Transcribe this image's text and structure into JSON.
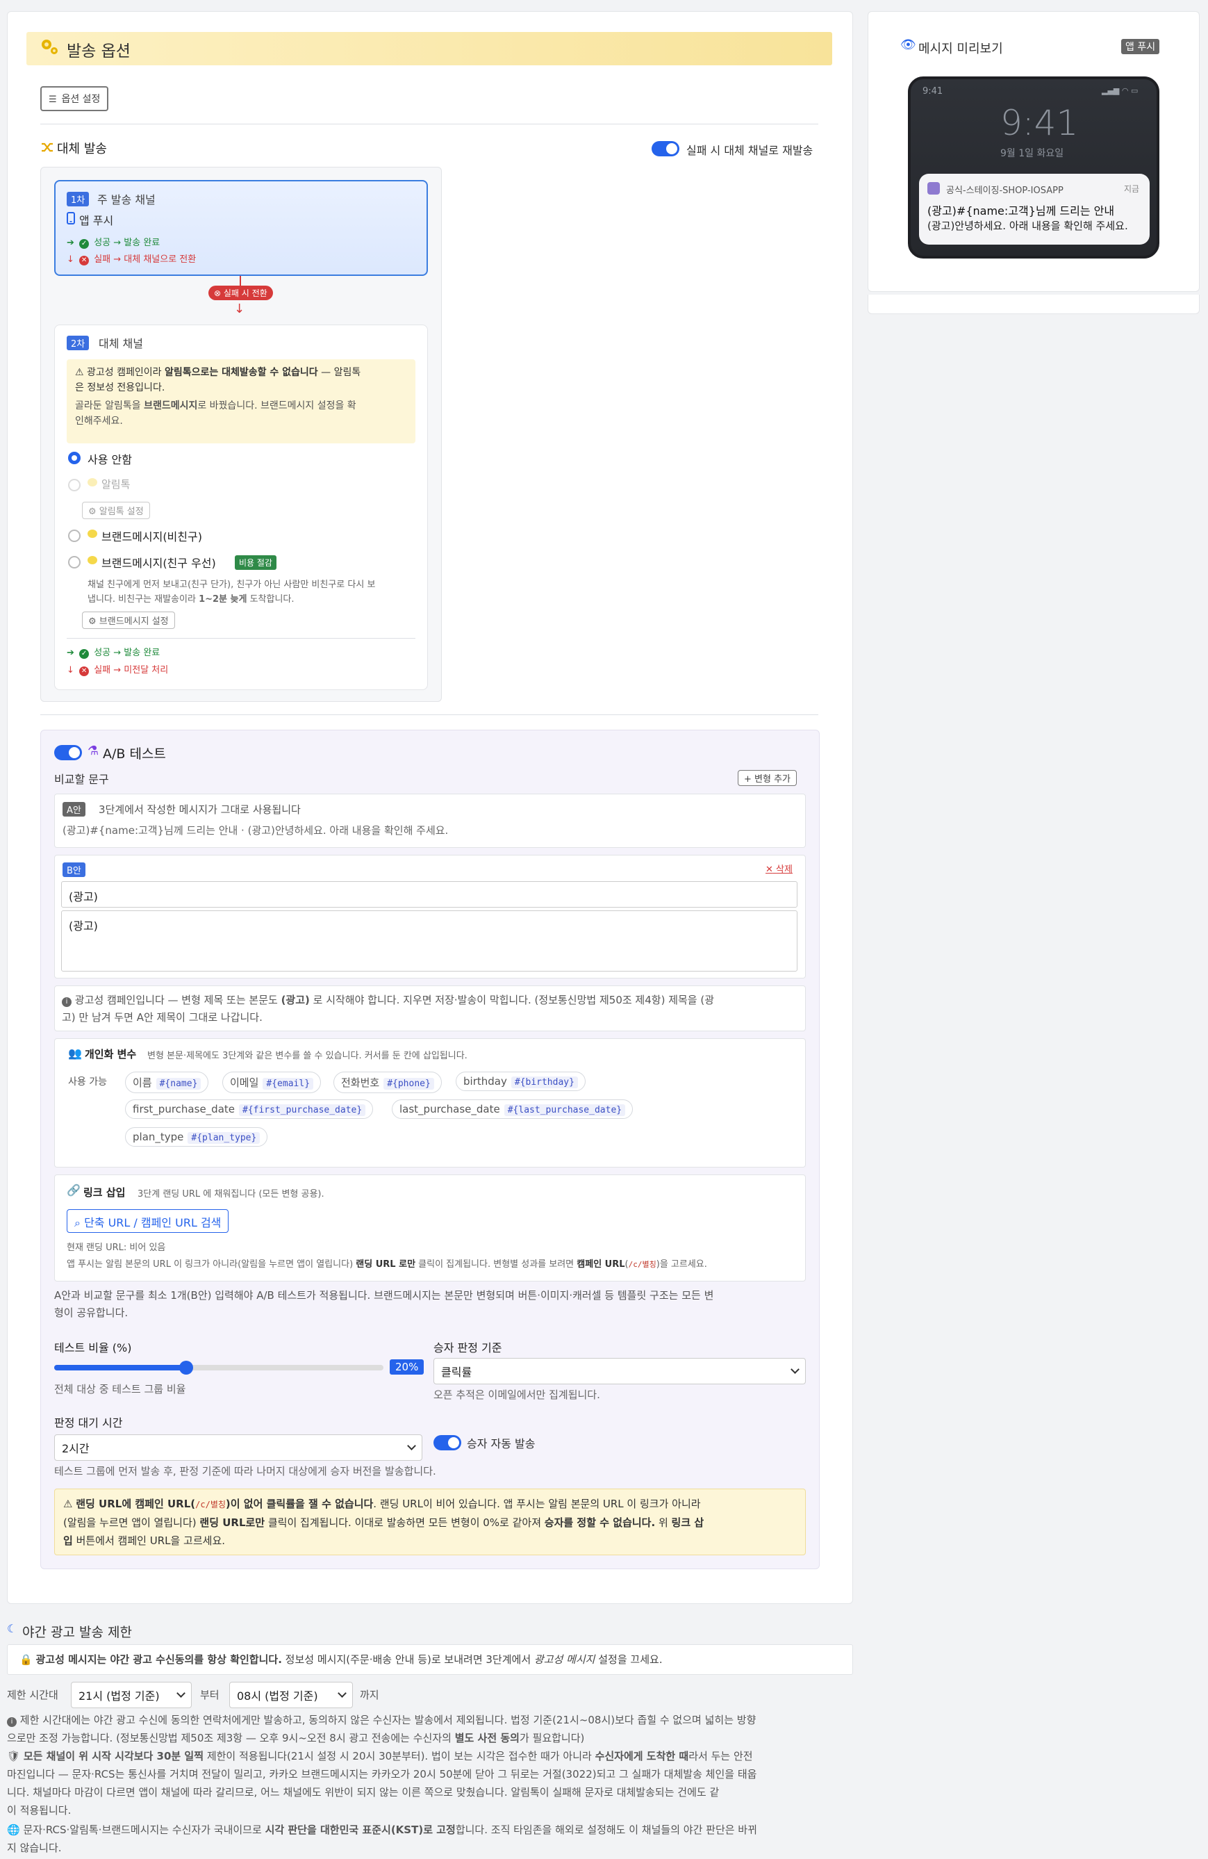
{
  "send_options": {
    "title": "발송 옵션",
    "option_settings_button": "옵션 설정",
    "fallback": {
      "title": "대체 발송",
      "toggle_label": "실패 시 대체 채널로 재발송",
      "primary": {
        "badge": "1차",
        "title": "주 발송 채널",
        "channel": "앱 푸시",
        "success": "성공 → 발송 완료",
        "failure": "실패 → 대체 채널으로 전환"
      },
      "connector_label": "실패 시 전환",
      "secondary": {
        "badge": "2차",
        "title": "대체 채널",
        "warning_line1_pre": "광고성 캠페인이라 ",
        "warning_line1_bold": "알림톡으로는 대체발송할 수 없습니다",
        "warning_line1_post": " — 알림톡",
        "warning_line2": "은 정보성 전용입니다.",
        "warning_line3_pre": "골라둔 알림톡을 ",
        "warning_line3_bold": "브랜드메시지",
        "warning_line3_post": "로 바꿨습니다. 브랜드메시지 설정을 확",
        "warning_line4": "인해주세요.",
        "options": {
          "none": "사용 안함",
          "alimtalk": "알림톡",
          "alimtalk_settings": "알림톡 설정",
          "brand_nonfriend": "브랜드메시지(비친구)",
          "brand_friend": "브랜드메시지(친구 우선)",
          "cost_badge": "비용 절감",
          "brand_desc_line1": "채널 친구에게 먼저 보내고(친구 단가), 친구가 아닌 사람만 비친구로 다시 보",
          "brand_desc_line2_pre": "냅니다. 비친구는 재발송이라 ",
          "brand_desc_line2_bold": "1~2분 늦게",
          "brand_desc_line2_post": " 도착합니다.",
          "brand_settings": "브랜드메시지 설정"
        },
        "success": "성공 → 발송 완료",
        "failure": "실패 → 미전달 처리"
      }
    },
    "ab_test": {
      "title": "A/B 테스트",
      "compare_label": "비교할 문구",
      "add_variant": "변형 추가",
      "variant_a": {
        "badge": "A안",
        "desc": "3단계에서 작성한 메시지가 그대로 사용됩니다",
        "preview": "(광고)#{name:고객}님께 드리는 안내 · (광고)안녕하세요. 아래 내용을 확인해 주세요."
      },
      "variant_b": {
        "badge": "B안",
        "delete": "삭제",
        "title_value": "(광고)",
        "body_value": "(광고)"
      },
      "ad_notice_line1_pre": "광고성 캠페인입니다 — 변형 제목 또는 본문도 ",
      "ad_notice_line1_bold": "(광고)",
      "ad_notice_line1_post": " 로 시작해야 합니다. 지우면 저장·발송이 막힙니다. (정보통신망법 제50조 제4항) 제목을 (광",
      "ad_notice_line2": "고) 만 남겨 두면 A안 제목이 그대로 나갑니다.",
      "personalization": {
        "title": "개인화 변수",
        "desc": "변형 본문·제목에도 3단계와 같은 변수를 쓸 수 있습니다. 커서를 둔 칸에 삽입됩니다.",
        "available_label": "사용 가능",
        "vars": [
          {
            "label": "이름",
            "code": "#{name}"
          },
          {
            "label": "이메일",
            "code": "#{email}"
          },
          {
            "label": "전화번호",
            "code": "#{phone}"
          },
          {
            "label": "birthday",
            "code": "#{birthday}"
          },
          {
            "label": "first_purchase_date",
            "code": "#{first_purchase_date}"
          },
          {
            "label": "last_purchase_date",
            "code": "#{last_purchase_date}"
          },
          {
            "label": "plan_type",
            "code": "#{plan_type}"
          }
        ]
      },
      "link_insert": {
        "title": "링크 삽입",
        "desc": "3단계 랜딩 URL 에 채워집니다 (모든 변형 공용).",
        "search_button": "단축 URL / 캠페인 URL 검색",
        "current_url": "현재 랜딩 URL: 비어 있음",
        "note_pre": "앱 푸시는 알림 본문의 URL 이 링크가 아니라(알림을 누르면 앱이 열립니다) ",
        "note_bold1": "랜딩 URL 로만",
        "note_mid": " 클릭이 집계됩니다. 변형별 성과를 보려면 ",
        "note_bold2": "캠페인 URL",
        "note_code": "/c/별칭",
        "note_post": "을 고르세요."
      },
      "apply_note_line1": "A안과 비교할 문구를 최소 1개(B안) 입력해야 A/B 테스트가 적용됩니다. 브랜드메시지는 본문만 변형되며 버튼·이미지·캐러셀 등 템플릿 구조는 모든 변",
      "apply_note_line2": "형이 공유합니다.",
      "test_ratio_label": "테스트 비율 (%)",
      "test_ratio_value": 20,
      "test_ratio_text": "20%",
      "test_ratio_help": "전체 대상 중 테스트 그룹 비율",
      "winner_label": "승자 판정 기준",
      "winner_value": "클릭률",
      "winner_help": "오픈 추적은 이메일에서만 집계됩니다.",
      "wait_label": "판정 대기 시간",
      "wait_value": "2시간",
      "auto_send_label": "승자 자동 발송",
      "wait_help": "테스트 그룹에 먼저 발송 후, 판정 기준에 따라 나머지 대상에게 승자 버전을 발송합니다.",
      "alert_line1_a": "랜딩 URL",
      "alert_line1_b": "에 캠페인 URL(",
      "alert_line1_code": "/c/별칭",
      "alert_line1_c": ")이 없어 클릭률을 잴 수 없습니다",
      "alert_line1_d": ". 랜딩 URL이 비어 있습니다. 앱 푸시는 알림 본문의 URL 이 링크가 아니라",
      "alert_line2_a": "(알림을 누르면 앱이 열립니다) ",
      "alert_line2_b": "랜딩 URL로만",
      "alert_line2_c": " 클릭이 집계됩니다. 이대로 발송하면 모든 변형이 0%로 같아져 ",
      "alert_line2_d": "승자를 정할 수 없습니다.",
      "alert_line2_e": " 위 ",
      "alert_line2_f": "링크 삽",
      "alert_line3_a": "입",
      "alert_line3_b": " 버튼에서 캠페인 URL을 고르세요."
    }
  },
  "night": {
    "title": "야간 광고 발송 제한",
    "consent_bold": "광고성 메시지는 야간 광고 수신동의를 항상 확인합니다.",
    "consent_rest": " 정보성 메시지(주문·배송 안내 등)로 보내려면 3단계에서 ",
    "consent_italic": "광고성 메시지",
    "consent_end": " 설정을 끄세요.",
    "limit_label": "제한 시간대",
    "from_value": "21시 (법정 기준)",
    "from_label": "부터",
    "to_value": "08시 (법정 기준)",
    "to_label": "까지",
    "info1_line1": "제한 시간대에는 야간 광고 수신에 동의한 연락처에게만 발송하고, 동의하지 않은 수신자는 발송에서 제외됩니다. 법정 기준(21시~08시)보다 좁힐 수 없으며 넓히는 방향",
    "info1_line2_pre": "으로만 조정 가능합니다. (정보통신망법 제50조 제3항 — 오후 9시~오전 8시 광고 전송에는 수신자의 ",
    "info1_line2_bold": "별도 사전 동의",
    "info1_line2_post": "가 필요합니다)",
    "info2_line1_bold1": "모든 채널이 위 시작 시각보다 30분 일찍",
    "info2_line1_mid": " 제한이 적용됩니다(21시 설정 시 20시 30분부터). 법이 보는 시각은 접수한 때가 아니라 ",
    "info2_line1_bold2": "수신자에게 도착한 때",
    "info2_line1_post": "라서 두는 안전",
    "info2_line2": "마진입니다 — 문자·RCS는 통신사를 거치며 전달이 밀리고, 카카오 브랜드메시지는 카카오가 20시 50분에 닫아 그 뒤로는 거절(3022)되고 그 실패가 대체발송 체인을 태웁",
    "info2_line3": "니다. 채널마다 마감이 다르면 앱이 채널에 따라 갈리므로, 어느 채널에도 위반이 되지 않는 이른 쪽으로 맞췄습니다. 알림톡이 실패해 문자로 대체발송되는 건에도 같",
    "info2_line4": "이 적용됩니다.",
    "info3_line1_pre": "문자·RCS·알림톡·브랜드메시지는 수신자가 국내이므로 ",
    "info3_line1_bold": "시각 판단을 대한민국 표준시(KST)로 고정",
    "info3_line1_post": "합니다. 조직 타임존을 해외로 설정해도 이 채널들의 야간 판단은 바뀌",
    "info3_line2": "지 않습니다."
  },
  "preview": {
    "title": "메시지 미리보기",
    "badge": "앱 푸시",
    "status_time": "9:41",
    "clock": "9:41",
    "date": "9월 1일 화요일",
    "app_name": "공식-스테이징-SHOP-IOSAPP",
    "notif_time": "지금",
    "notif_title": "(광고)#{name:고객}님께 드리는 안내",
    "notif_body": "(광고)안녕하세요. 아래 내용을 확인해 주세요."
  },
  "colors": {
    "accent": "#2563eb",
    "header_bg": "#fbe9a8",
    "success": "#1f8a3b",
    "danger": "#d63a3a",
    "warn_bg": "#fdf6d8",
    "phone_bg": "#2b2d33"
  }
}
